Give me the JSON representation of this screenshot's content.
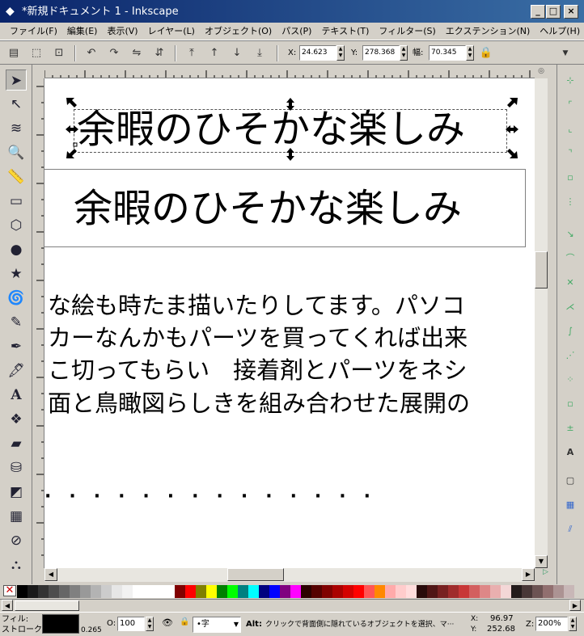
{
  "window": {
    "title": "*新規ドキュメント 1 - Inkscape",
    "minimize": "_",
    "maximize": "□",
    "close": "×"
  },
  "menu": [
    "ファイル(F)",
    "編集(E)",
    "表示(V)",
    "レイヤー(L)",
    "オブジェクト(O)",
    "パス(P)",
    "テキスト(T)",
    "フィルター(S)",
    "エクステンション(N)",
    "ヘルプ(H)"
  ],
  "toolbar": {
    "x_label": "X:",
    "x_value": "24.623",
    "y_label": "Y:",
    "y_value": "278.368",
    "w_label": "幅:",
    "w_value": "70.345"
  },
  "ruler": {
    "top_ticks": [
      "",
      "",
      "",
      "",
      "",
      "",
      "",
      "",
      "",
      "",
      "",
      "",
      ""
    ],
    "left_ticks": []
  },
  "canvas": {
    "heading_selected": "余暇のひそかな楽しみ",
    "heading_framed": "余暇のひそかな楽しみ",
    "lines": [
      "な絵も時たま描いたりしてます。パソコ",
      "カーなんかもパーツを買ってくれば出来",
      "こ切ってもらい　接着剤とパーツをネシ",
      "面と鳥瞰図らしきを組み合わせた展開の"
    ],
    "dots": "·　·　·　·　·　·　·　·　·　·　·　·　·　·"
  },
  "status": {
    "fill_label": "フィル:",
    "stroke_label": "ストローク:",
    "stroke_width": "0.265",
    "opacity_label": "O:",
    "opacity_value": "100",
    "layer_value": "•字",
    "message_key": "Alt:",
    "message": "クリックで背面側に隠れているオブジェクトを選択、マ···",
    "cursor_x_label": "X:",
    "cursor_x": "96.97",
    "cursor_y_label": "Y:",
    "cursor_y": "252.68",
    "zoom_label": "Z:",
    "zoom_value": "200%"
  },
  "colors": {
    "title_start": "#0a246a",
    "title_end": "#3a6ea5",
    "chrome": "#d4d0c8"
  }
}
